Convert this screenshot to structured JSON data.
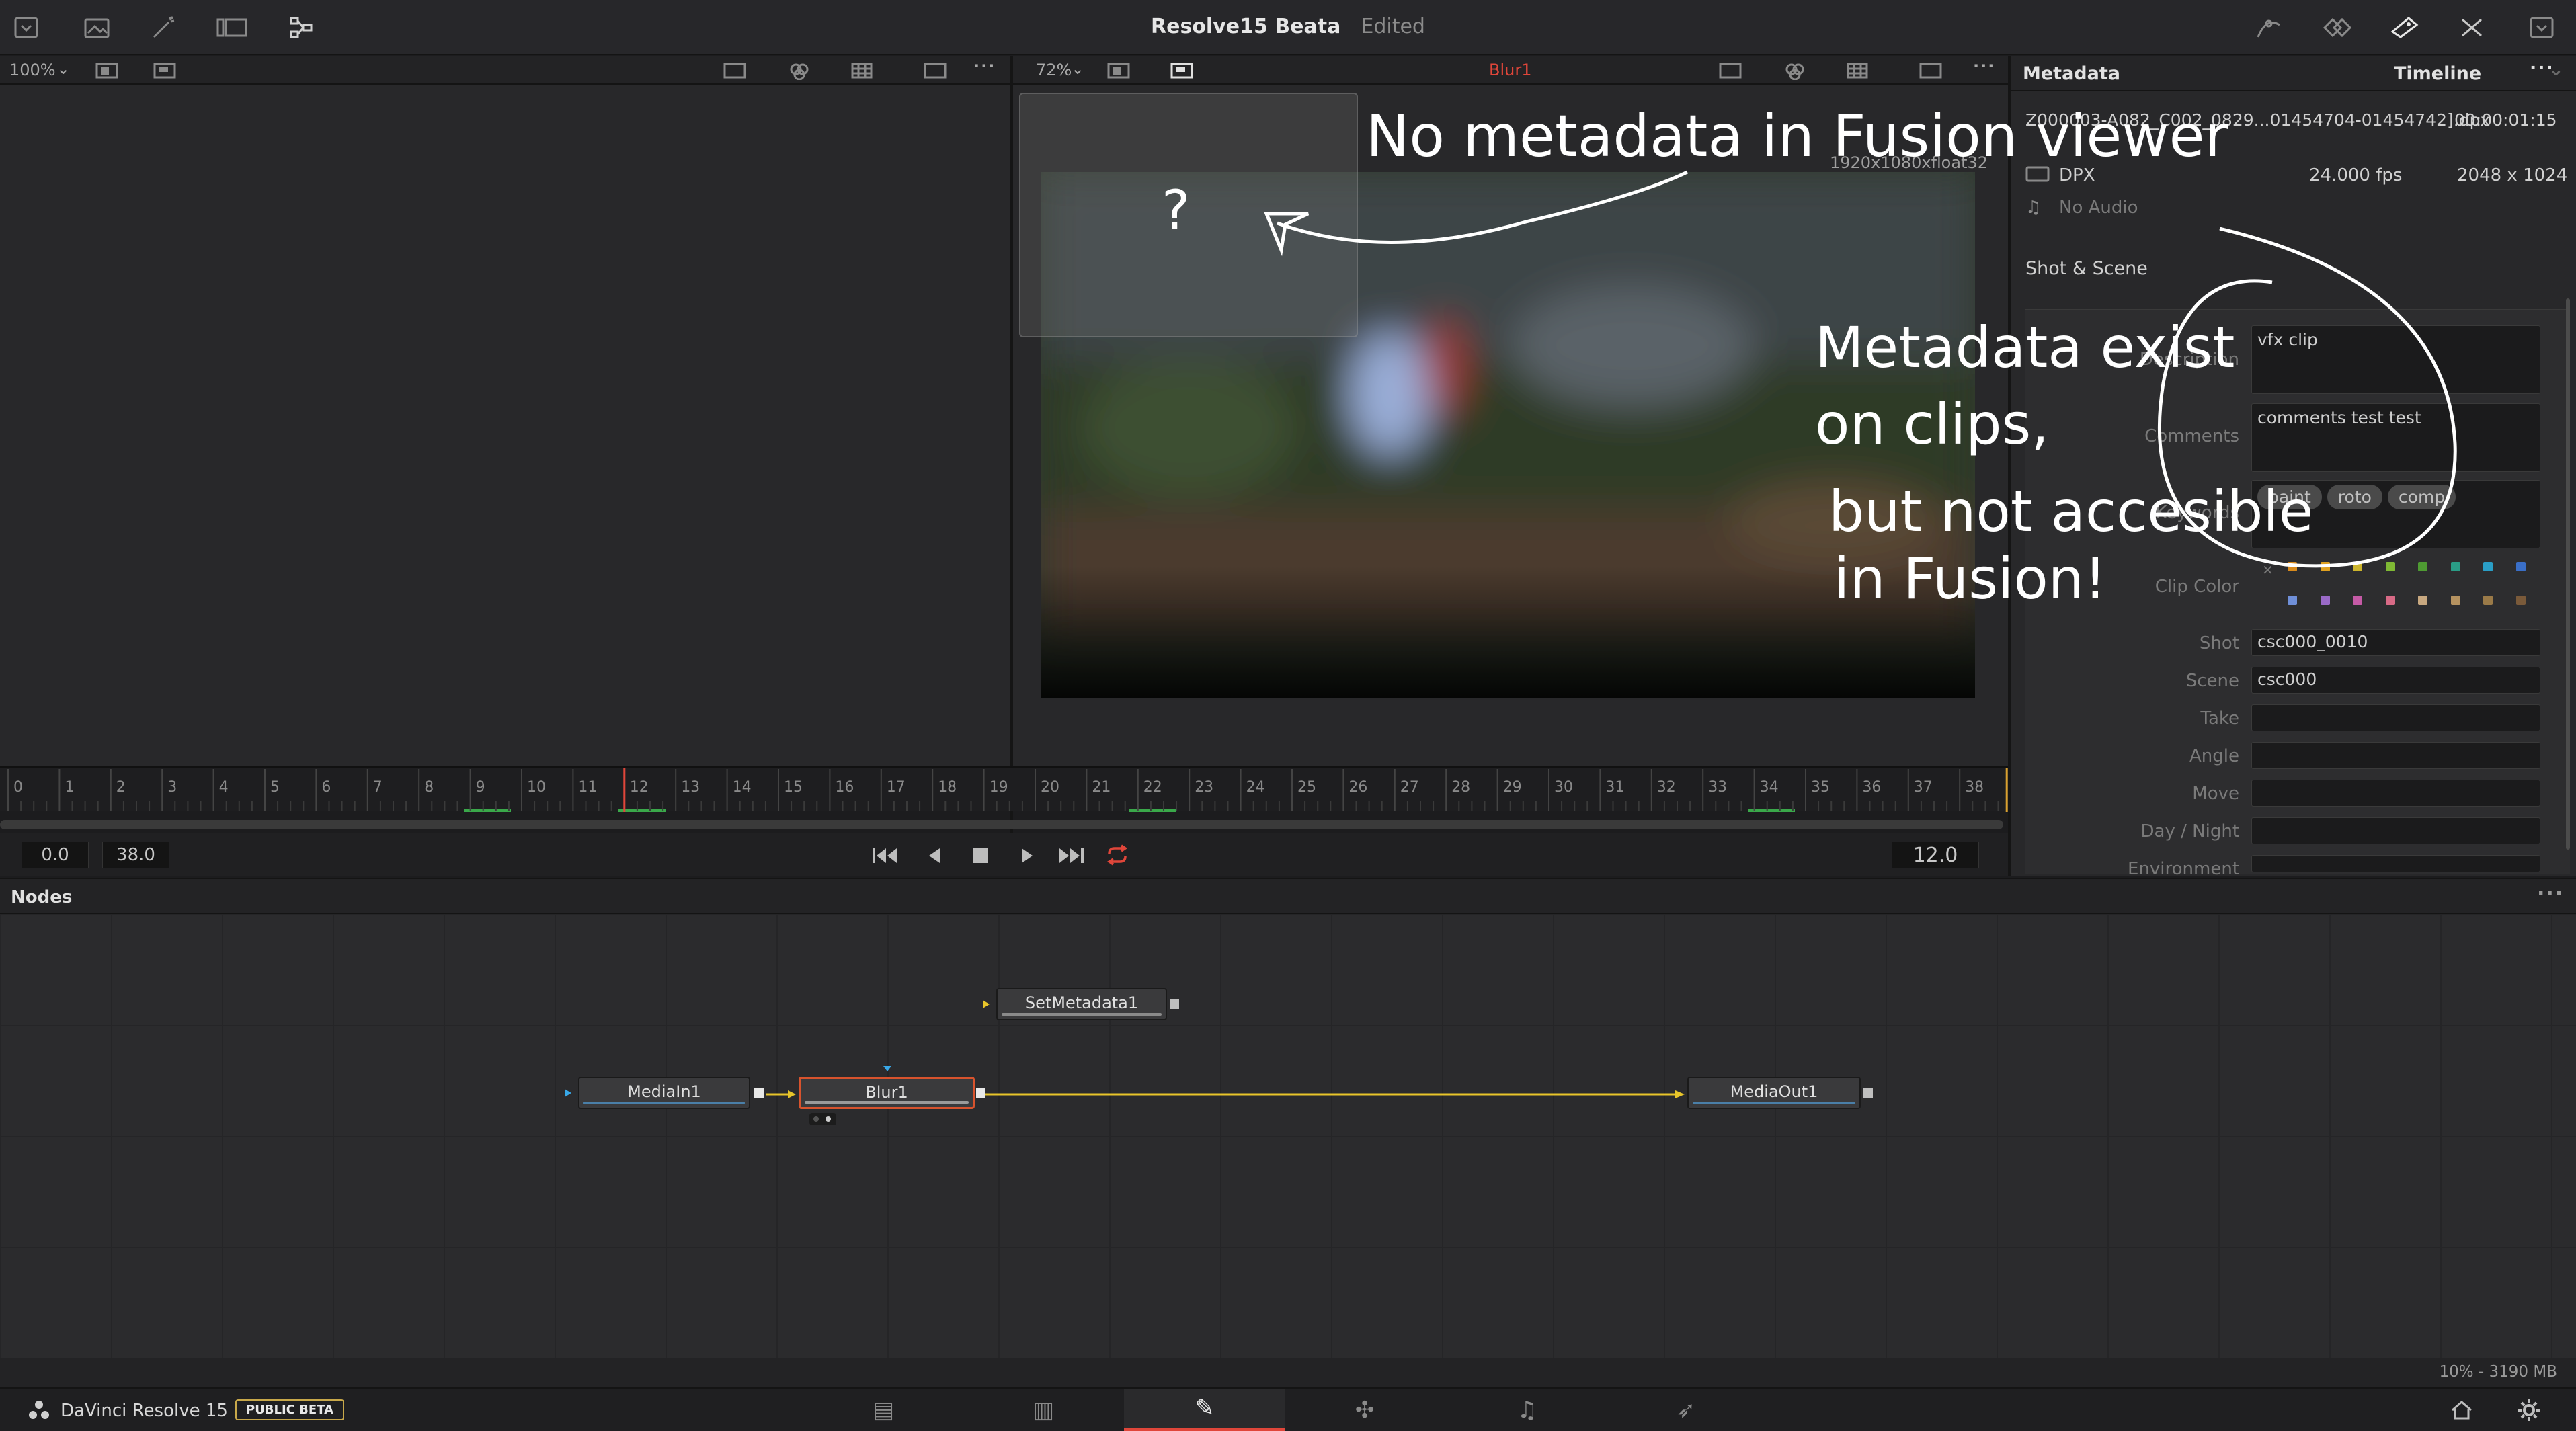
{
  "app": {
    "project_title": "Resolve15 Beata",
    "edit_status": "Edited",
    "name": "DaVinci Resolve 15",
    "beta_badge": "PUBLIC BETA",
    "memory_status": "10% - 3190 MB"
  },
  "left_viewer": {
    "zoom": "100%"
  },
  "right_viewer": {
    "zoom": "72%",
    "node_name": "Blur1",
    "resolution": "1920x1080xfloat32"
  },
  "ruler": {
    "ticks": [
      "0",
      "1",
      "2",
      "3",
      "4",
      "5",
      "6",
      "7",
      "8",
      "9",
      "10",
      "11",
      "12",
      "13",
      "14",
      "15",
      "16",
      "17",
      "18",
      "19",
      "20",
      "21",
      "22",
      "23",
      "24",
      "25",
      "26",
      "27",
      "28",
      "29",
      "30",
      "31",
      "32",
      "33",
      "34",
      "35",
      "36",
      "37",
      "38"
    ],
    "playhead": 12
  },
  "transport": {
    "start": "0.0",
    "end": "38.0",
    "current_frame": "12.0"
  },
  "metadata_panel": {
    "title": "Metadata",
    "mode": "Timeline",
    "clip_name": "Z000003-A082_C002_0829...01454704-01454742].dpx",
    "clip_duration": "00:00:01:15",
    "format": "DPX",
    "fps": "24.000 fps",
    "resolution": "2048 x 1024",
    "audio": "No Audio",
    "section_title": "Shot & Scene",
    "fields": {
      "description": {
        "label": "Description",
        "value": "vfx clip"
      },
      "comments": {
        "label": "Comments",
        "value": "comments test test"
      },
      "keywords": {
        "label": "Keywords",
        "values": [
          "paint",
          "roto",
          "comp"
        ]
      },
      "clip_color": {
        "label": "Clip Color"
      },
      "shot": {
        "label": "Shot",
        "value": "csc000_0010"
      },
      "scene": {
        "label": "Scene",
        "value": "csc000"
      },
      "take": {
        "label": "Take",
        "value": ""
      },
      "angle": {
        "label": "Angle",
        "value": ""
      },
      "move": {
        "label": "Move",
        "value": ""
      },
      "day_night": {
        "label": "Day / Night",
        "value": ""
      },
      "environment": {
        "label": "Environment",
        "value": ""
      }
    },
    "clip_colors_row1": [
      "#d88a1c",
      "#e0a11f",
      "#cdb52c",
      "#7fb934",
      "#4e9a32",
      "#2a9c86",
      "#2a9ec6",
      "#3a6fc8"
    ],
    "clip_colors_row2": [
      "#6f8fd8",
      "#9a6ac8",
      "#c55aa6",
      "#d86a86",
      "#c8a880",
      "#b59260",
      "#9a7a48",
      "#7a5a3a"
    ]
  },
  "nodes_panel": {
    "title": "Nodes",
    "nodes": {
      "set_metadata": "SetMetadata1",
      "media_in": "MediaIn1",
      "blur": "Blur1",
      "media_out": "MediaOut1"
    }
  },
  "annotations": {
    "note_top": "No metadata in Fusion viewer",
    "question": "?",
    "note_right_lines": [
      "Metadata exist",
      "on clips,",
      "but not accesible",
      "in Fusion!"
    ]
  },
  "page_tabs": [
    "media-page",
    "cut-page",
    "edit-page",
    "fusion-page",
    "color-page",
    "fairlight-page",
    "deliver-page"
  ],
  "colors": {
    "accent_red": "#e0463a",
    "connection_yellow": "#e8c52a",
    "selected_orange": "#d8532d"
  }
}
